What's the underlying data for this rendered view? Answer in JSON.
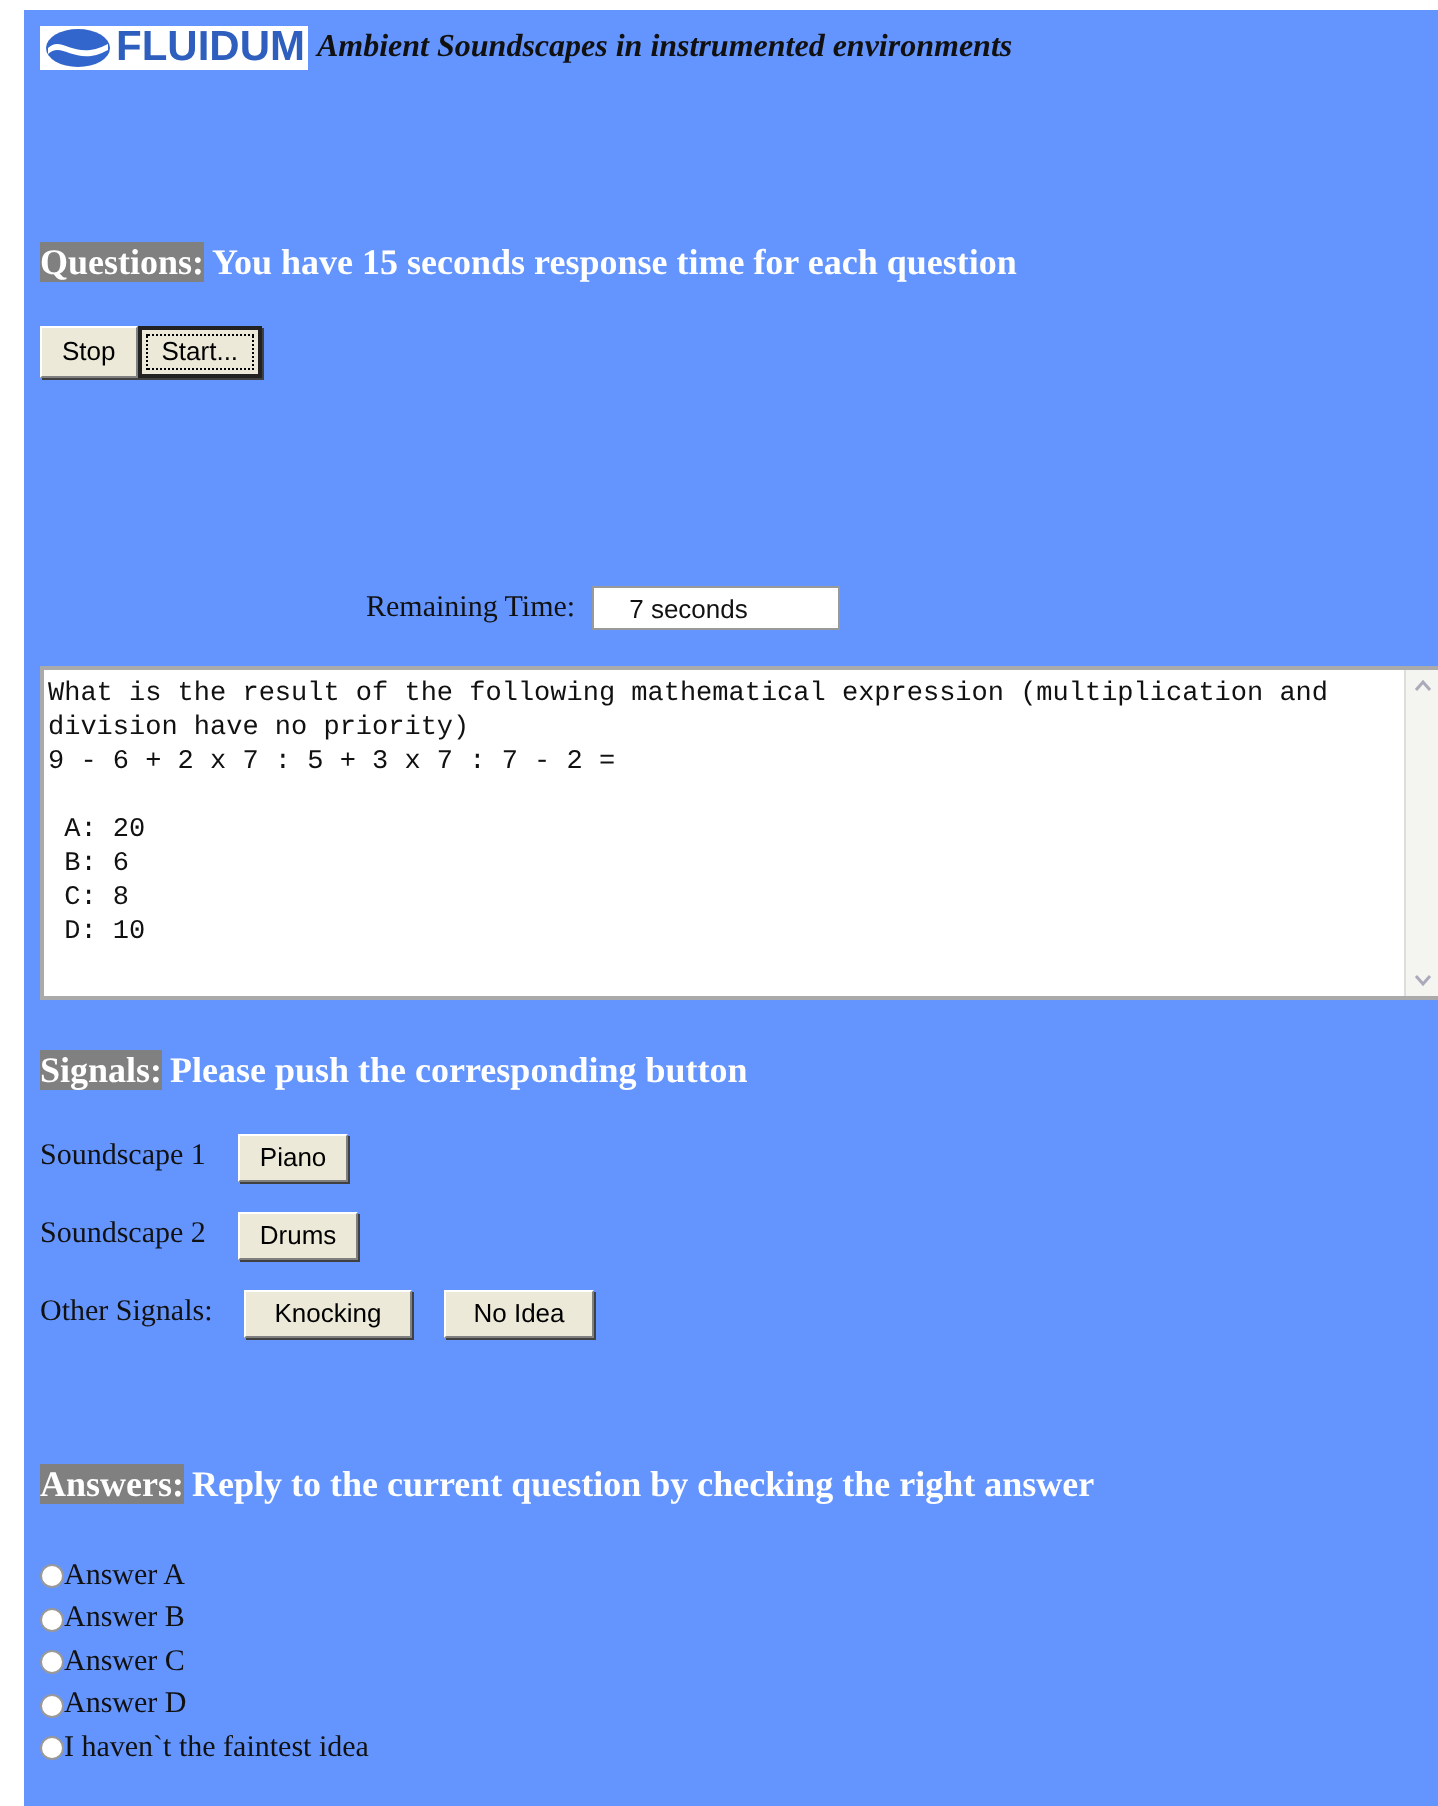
{
  "header": {
    "logo_text": "FLUIDUM",
    "subtitle": "Ambient Soundscapes in instrumented environments"
  },
  "questions": {
    "label": "Questions:",
    "text": "You have 15 seconds response time for each question",
    "buttons": [
      {
        "label": "Stop",
        "focused": false
      },
      {
        "label": "Start...",
        "focused": true
      }
    ],
    "remaining_label": "Remaining Time:",
    "remaining_value": "7 seconds",
    "question_lines": [
      "What is the result of the following mathematical expression (multiplication and division have no priority)",
      "9 - 6 + 2 x 7 : 5 + 3 x 7 : 7 - 2 ="
    ],
    "choice_lines": [
      " A: 20",
      " B: 6",
      " C: 8",
      " D: 10"
    ]
  },
  "signals": {
    "label": "Signals:",
    "text": "Please push the corresponding button",
    "rows": [
      {
        "label": "Soundscape 1",
        "buttons": [
          "Piano"
        ]
      },
      {
        "label": "Soundscape 2",
        "buttons": [
          "Drums"
        ]
      },
      {
        "label": "Other Signals:",
        "buttons": [
          "Knocking",
          "No Idea"
        ]
      }
    ]
  },
  "answers": {
    "label": "Answers:",
    "text": "Reply to the current question by checking the right answer",
    "options": [
      {
        "label": "Answer A",
        "selected": false
      },
      {
        "label": "Answer B",
        "selected": false
      },
      {
        "label": "Answer C",
        "selected": false
      },
      {
        "label": "Answer D",
        "selected": false
      },
      {
        "label": "I haven`t the faintest idea",
        "selected": false
      }
    ]
  }
}
